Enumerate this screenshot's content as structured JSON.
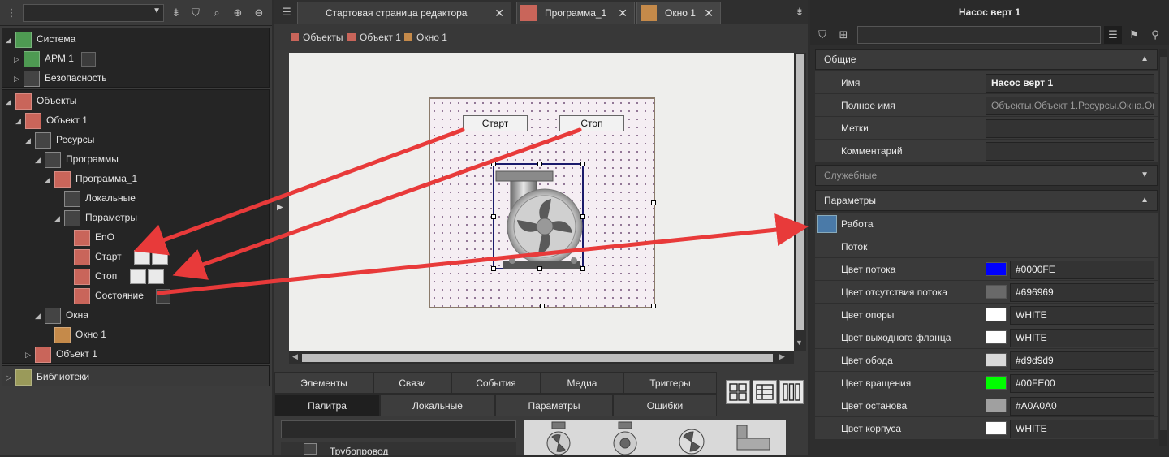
{
  "left_panel": {
    "tree_system": {
      "root": "Система",
      "items": [
        "АРМ 1",
        "Безопасность"
      ]
    },
    "tree_objects": {
      "root": "Объекты",
      "object1": "Объект 1",
      "resources": "Ресурсы",
      "programs": "Программы",
      "program1": "Программа_1",
      "locals": "Локальные",
      "params": "Параметры",
      "param_items": [
        "EnO",
        "Старт",
        "Стоп",
        "Состояние"
      ],
      "windows": "Окна",
      "window1": "Окно 1",
      "object1_b": "Объект 1"
    },
    "libraries": "Библиотеки"
  },
  "tabs": [
    {
      "label": "Стартовая страница редактора проектов",
      "icon": "list-icon"
    },
    {
      "label": "Программа_1",
      "icon": "program-icon"
    },
    {
      "label": "Окно 1",
      "icon": "window-icon"
    }
  ],
  "breadcrumb": [
    {
      "label": "Объекты",
      "color": "#c9655a"
    },
    {
      "label": "Объект 1",
      "color": "#c9655a"
    },
    {
      "label": "Окно 1",
      "color": "#c58a4a"
    }
  ],
  "canvas": {
    "start_button": "Старт",
    "stop_button": "Стоп"
  },
  "bottom_tabs_row1": [
    "Элементы",
    "Связи",
    "События",
    "Медиа",
    "Триггеры"
  ],
  "bottom_tabs_row2": [
    "Палитра",
    "Локальные",
    "Параметры",
    "Ошибки"
  ],
  "palette_partial_item": "Трубопровод",
  "right_panel": {
    "title": "Насос верт 1",
    "groups": {
      "general": "Общие",
      "service": "Служебные",
      "params": "Параметры"
    },
    "general_props": [
      {
        "label": "Имя",
        "value": "Насос верт 1"
      },
      {
        "label": "Полное имя",
        "value": "Объекты.Объект 1.Ресурсы.Окна.Ок"
      },
      {
        "label": "Метки",
        "value": ""
      },
      {
        "label": "Комментарий",
        "value": ""
      }
    ],
    "param_props": [
      {
        "label": "Работа",
        "value": ""
      },
      {
        "label": "Поток",
        "value": ""
      },
      {
        "label": "Цвет потока",
        "value": "#0000FE",
        "color": "#0000FE"
      },
      {
        "label": "Цвет отсутствия потока",
        "value": "#696969",
        "color": "#696969"
      },
      {
        "label": "Цвет опоры",
        "value": "WHITE",
        "color": "#FFFFFF"
      },
      {
        "label": "Цвет выходного фланца",
        "value": "WHITE",
        "color": "#FFFFFF"
      },
      {
        "label": "Цвет обода",
        "value": "#d9d9d9",
        "color": "#d9d9d9"
      },
      {
        "label": "Цвет вращения",
        "value": "#00FE00",
        "color": "#00FE00"
      },
      {
        "label": "Цвет останова",
        "value": "#A0A0A0",
        "color": "#A0A0A0"
      },
      {
        "label": "Цвет корпуса",
        "value": "WHITE",
        "color": "#FFFFFF"
      }
    ]
  },
  "colors": {
    "arrow": "#e83a3a",
    "accent_green": "#4e9a52",
    "accent_red": "#c9655a",
    "accent_orange": "#c58a4a"
  }
}
